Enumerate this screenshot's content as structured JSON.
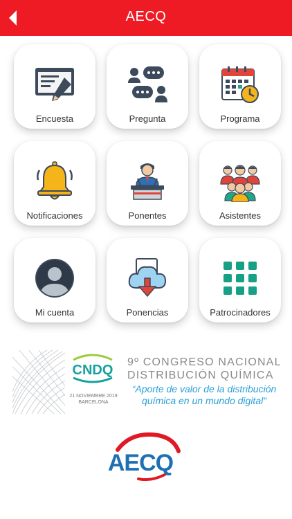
{
  "header": {
    "title": "AECQ"
  },
  "menu": [
    {
      "label": "Encuesta",
      "icon": "survey-icon"
    },
    {
      "label": "Pregunta",
      "icon": "chat-icon"
    },
    {
      "label": "Programa",
      "icon": "calendar-icon"
    },
    {
      "label": "Notificaciones",
      "icon": "bell-icon"
    },
    {
      "label": "Ponentes",
      "icon": "speaker-icon"
    },
    {
      "label": "Asistentes",
      "icon": "attendees-icon"
    },
    {
      "label": "Mi cuenta",
      "icon": "account-icon"
    },
    {
      "label": "Ponencias",
      "icon": "cloud-download-icon"
    },
    {
      "label": "Patrocinadores",
      "icon": "grid-icon"
    }
  ],
  "banner": {
    "logo_text": "CNDQ",
    "date": "21 NOVIEMBRE 2019",
    "city": "BARCELONA",
    "title_line1": "9º CONGRESO NACIONAL",
    "title_line2": "DISTRIBUCIÓN QUÍMICA",
    "subtitle_line1": "“Aporte de valor de la distribución",
    "subtitle_line2": "química en un mundo digital”"
  },
  "footer": {
    "logo_text": "AECQ"
  },
  "colors": {
    "header": "#ee1a24",
    "accent_green": "#16a085",
    "accent_blue": "#2a9fd8"
  }
}
